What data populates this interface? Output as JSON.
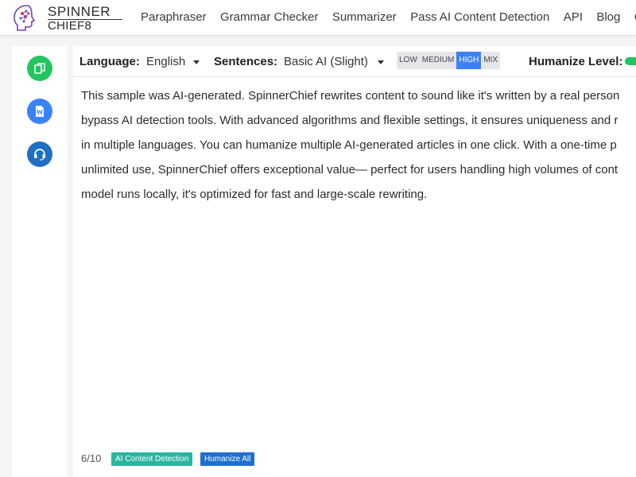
{
  "brand": {
    "line1": "SPINNER",
    "line2": "CHIEF8"
  },
  "nav": {
    "items": [
      "Paraphraser",
      "Grammar Checker",
      "Summarizer",
      "Pass AI Content Detection",
      "API",
      "Blog",
      "Q"
    ]
  },
  "sidebar": {
    "icons": [
      "copy-icon",
      "word-document-icon",
      "headset-support-icon"
    ],
    "colors": [
      "#22c55e",
      "#3b82f6",
      "#1f6fc5"
    ]
  },
  "toolbar": {
    "language_label": "Language:",
    "language_value": "English",
    "sentences_label": "Sentences:",
    "sentences_value": "Basic AI (Slight)",
    "levels": [
      "LOW",
      "MEDIUM",
      "HIGH",
      "MIX"
    ],
    "active_level": "HIGH",
    "humanize_label": "Humanize Level:"
  },
  "content": {
    "lines": [
      "This sample was AI-generated. SpinnerChief rewrites content to sound like it's written by a real person",
      "bypass AI detection tools. With advanced algorithms and flexible settings, it ensures uniqueness and r",
      "in multiple languages. You can humanize multiple AI-generated articles in one click. With a one-time p",
      "unlimited use, SpinnerChief offers exceptional value— perfect for users handling high volumes of cont",
      "model runs locally, it's optimized for fast and large-scale rewriting."
    ]
  },
  "footer": {
    "counter": "6/10",
    "detect_button": "AI Content Detection",
    "humanize_button": "Humanize All",
    "detect_color": "#2bb5a0",
    "humanize_color": "#1e6fd0"
  }
}
